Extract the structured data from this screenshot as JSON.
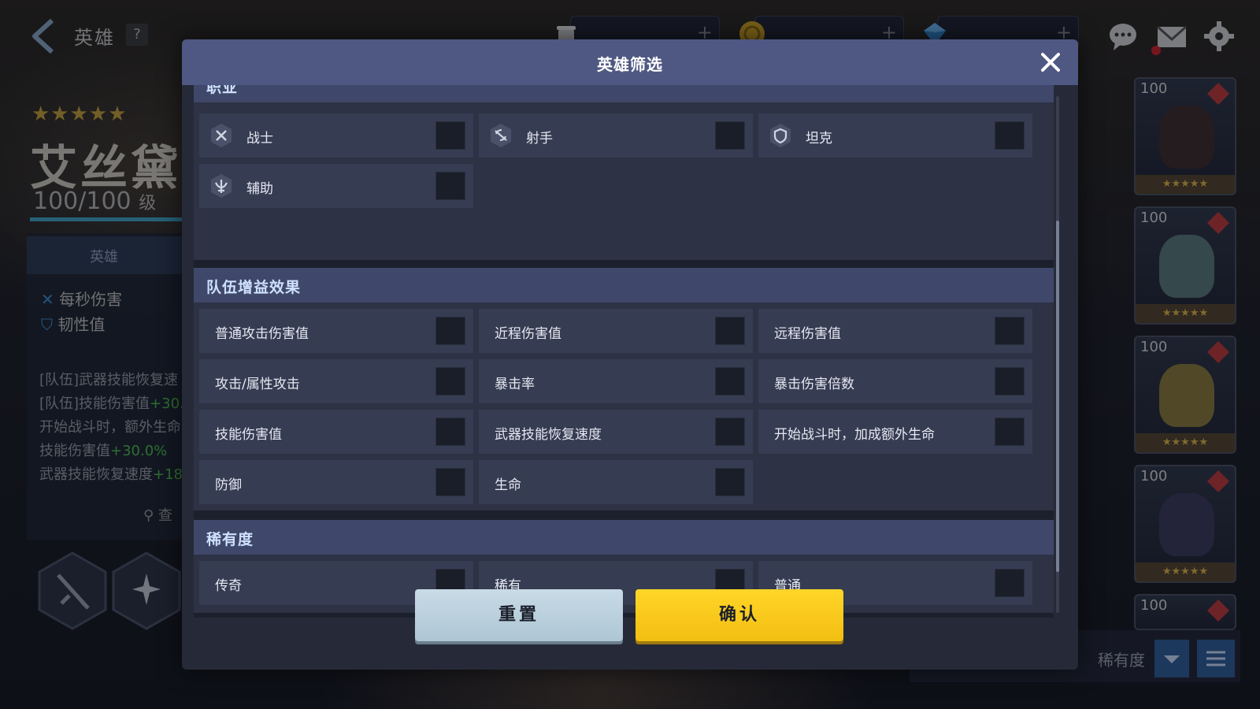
{
  "screen": {
    "page_title": "英雄",
    "help_label": "?",
    "resources": [
      {
        "icon": "coffee-cup-icon"
      },
      {
        "icon": "gold-coin-icon"
      },
      {
        "icon": "gem-icon"
      }
    ],
    "resource_plus": "+"
  },
  "hero": {
    "stars": "★★★★★",
    "name": "艾丝黛",
    "level": "100/100",
    "level_unit": "级",
    "tab_label": "英雄",
    "stats": [
      "每秒伤害",
      "韧性值"
    ],
    "effects": [
      {
        "text": "[队伍]武器技能恢复速",
        "bonus": ""
      },
      {
        "text": "[队伍]技能伤害值",
        "bonus": "+30."
      },
      {
        "text": "开始战斗时，额外生命",
        "bonus": ""
      },
      {
        "text": "技能伤害值",
        "bonus": "+30.0%"
      },
      {
        "text": "武器技能恢复速度",
        "bonus": "+18"
      }
    ],
    "search_label": "查"
  },
  "roster": {
    "card_level": "100",
    "card_stars": "★★★★★",
    "sort_label": "稀有度"
  },
  "modal": {
    "title": "英雄筛选",
    "close_icon": "close-icon",
    "class_section": {
      "title": "职业",
      "options": [
        {
          "label": "战士",
          "icon": "crossed-swords-icon",
          "checked": false
        },
        {
          "label": "射手",
          "icon": "crossbow-icon",
          "checked": false
        },
        {
          "label": "坦克",
          "icon": "shield-icon",
          "checked": false
        },
        {
          "label": "辅助",
          "icon": "support-icon",
          "checked": false
        }
      ]
    },
    "buff_section": {
      "title": "队伍增益效果",
      "options": [
        {
          "label": "普通攻击伤害值",
          "checked": false
        },
        {
          "label": "近程伤害值",
          "checked": false
        },
        {
          "label": "远程伤害值",
          "checked": false
        },
        {
          "label": "攻击/属性攻击",
          "checked": false
        },
        {
          "label": "暴击率",
          "checked": false
        },
        {
          "label": "暴击伤害倍数",
          "checked": false
        },
        {
          "label": "技能伤害值",
          "checked": false
        },
        {
          "label": "武器技能恢复速度",
          "checked": false
        },
        {
          "label": "开始战斗时，加成额外生命",
          "checked": false
        },
        {
          "label": "防御",
          "checked": false
        },
        {
          "label": "生命",
          "checked": false
        }
      ]
    },
    "rarity_section": {
      "title": "稀有度",
      "options": [
        {
          "label": "传奇",
          "checked": false
        },
        {
          "label": "稀有",
          "checked": false
        },
        {
          "label": "普通",
          "checked": false
        }
      ]
    },
    "reset_label": "重置",
    "confirm_label": "确认"
  },
  "colors": {
    "modal_header": "#4e5882",
    "section_header": "#3f486a",
    "option_bg": "#363c52",
    "confirm_yellow": "#ffd628",
    "reset_blue": "#c8dbe6"
  }
}
